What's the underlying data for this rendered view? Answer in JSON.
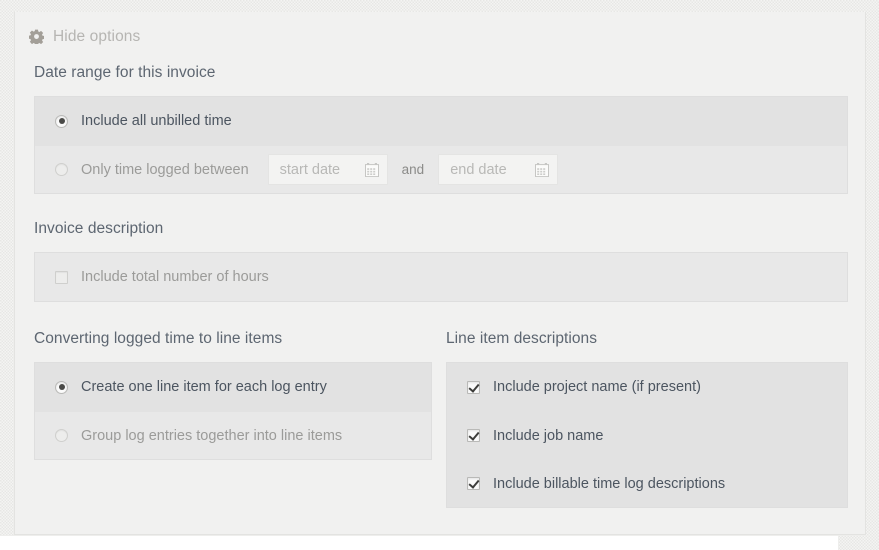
{
  "header": {
    "gear_icon": "gear-icon",
    "toggle_label": "Hide options"
  },
  "sections": {
    "date_range": {
      "heading": "Date range for this invoice",
      "options": [
        {
          "label": "Include all unbilled time",
          "type": "radio",
          "selected": true
        },
        {
          "label": "Only time logged between",
          "type": "radio",
          "selected": false
        }
      ],
      "start_date": {
        "placeholder": "start date",
        "value": "",
        "icon": "calendar-icon"
      },
      "end_date": {
        "placeholder": "end date",
        "value": "",
        "icon": "calendar-icon"
      },
      "separator": "and"
    },
    "invoice_description": {
      "heading": "Invoice description",
      "options": [
        {
          "label": "Include total number of hours",
          "type": "checkbox",
          "checked": false
        }
      ]
    },
    "converting": {
      "heading": "Converting logged time to line items",
      "options": [
        {
          "label": "Create one line item for each log entry",
          "type": "radio",
          "selected": true
        },
        {
          "label": "Group log entries together into line items",
          "type": "radio",
          "selected": false
        }
      ]
    },
    "line_item_descriptions": {
      "heading": "Line item descriptions",
      "options": [
        {
          "label": "Include project name (if present)",
          "type": "checkbox",
          "checked": true
        },
        {
          "label": "Include job name",
          "type": "checkbox",
          "checked": true
        },
        {
          "label": "Include billable time log descriptions",
          "type": "checkbox",
          "checked": true
        }
      ]
    }
  },
  "colors": {
    "page_background": "#e7e7e5",
    "panel_background": "#f1f1f0",
    "group_background": "#eaeaea",
    "row_selected": "#e2e2e2",
    "heading_text": "#5d6671",
    "label_text": "#4c5560",
    "muted_text": "#9b9b99",
    "placeholder_text": "#b8b8b6"
  }
}
